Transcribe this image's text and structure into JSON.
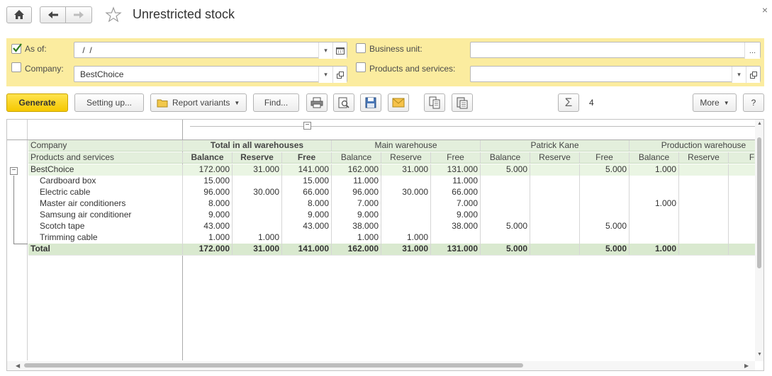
{
  "window": {
    "title": "Unrestricted stock",
    "close_glyph": "×"
  },
  "filters": {
    "as_of": {
      "label": "As of:",
      "checked": true,
      "value": " /  /"
    },
    "company": {
      "label": "Company:",
      "checked": false,
      "value": "BestChoice"
    },
    "business_unit": {
      "label": "Business unit:",
      "checked": false,
      "value": "",
      "button": "..."
    },
    "products_services": {
      "label": "Products and services:",
      "checked": false,
      "value": ""
    }
  },
  "toolbar": {
    "generate": "Generate",
    "setting_up": "Setting up...",
    "report_variants": "Report variants",
    "find": "Find...",
    "sum_value": "4",
    "more": "More",
    "help": "?"
  },
  "report": {
    "row_header_1": "Company",
    "row_header_2": "Products and services",
    "groups": [
      "Total in all warehouses",
      "Main warehouse",
      "Patrick Kane",
      "Production warehouse"
    ],
    "columns": [
      "Balance",
      "Reserve",
      "Free",
      "Balance",
      "Reserve",
      "Free",
      "Balance",
      "Reserve",
      "Free",
      "Balance",
      "Reserve",
      "Fr"
    ],
    "group_row": {
      "label": "BestChoice",
      "values": [
        "172.000",
        "31.000",
        "141.000",
        "162.000",
        "31.000",
        "131.000",
        "5.000",
        "",
        "5.000",
        "1.000",
        "",
        ""
      ]
    },
    "rows": [
      {
        "label": "Cardboard box",
        "values": [
          "15.000",
          "",
          "15.000",
          "11.000",
          "",
          "11.000",
          "",
          "",
          "",
          "",
          "",
          ""
        ]
      },
      {
        "label": "Electric cable",
        "values": [
          "96.000",
          "30.000",
          "66.000",
          "96.000",
          "30.000",
          "66.000",
          "",
          "",
          "",
          "",
          "",
          ""
        ]
      },
      {
        "label": "Master air conditioners",
        "values": [
          "8.000",
          "",
          "8.000",
          "7.000",
          "",
          "7.000",
          "",
          "",
          "",
          "1.000",
          "",
          ""
        ]
      },
      {
        "label": "Samsung air conditioner",
        "values": [
          "9.000",
          "",
          "9.000",
          "9.000",
          "",
          "9.000",
          "",
          "",
          "",
          "",
          "",
          ""
        ]
      },
      {
        "label": "Scotch tape",
        "values": [
          "43.000",
          "",
          "43.000",
          "38.000",
          "",
          "38.000",
          "5.000",
          "",
          "5.000",
          "",
          "",
          ""
        ]
      },
      {
        "label": "Trimming cable",
        "values": [
          "1.000",
          "1.000",
          "",
          "1.000",
          "1.000",
          "",
          "",
          "",
          "",
          "",
          "",
          ""
        ]
      }
    ],
    "total_row": {
      "label": "Total",
      "values": [
        "172.000",
        "31.000",
        "141.000",
        "162.000",
        "31.000",
        "131.000",
        "5.000",
        "",
        "5.000",
        "1.000",
        "",
        ""
      ]
    }
  },
  "colors": {
    "filter_panel": "#fbec9f",
    "generate_button": "#f5c800",
    "header_green": "#e3efdc",
    "group_row_green": "#eaf5e3",
    "total_row_green": "#d9e9cf"
  }
}
